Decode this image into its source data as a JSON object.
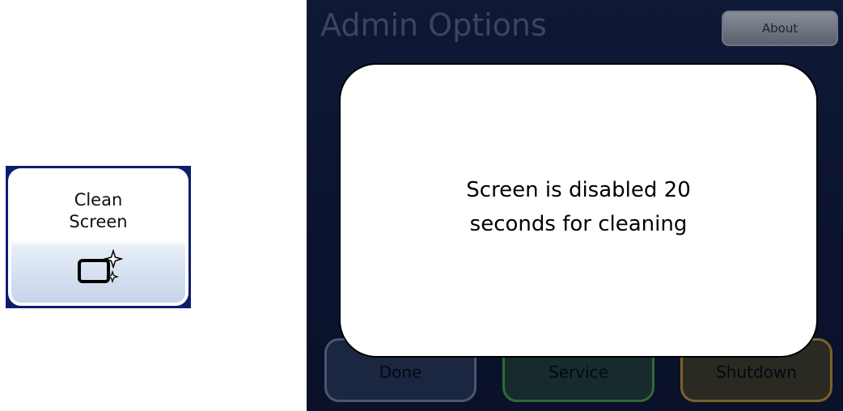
{
  "clean_screen_button": {
    "label": "Clean\nScreen",
    "icon": "clean-screen-sparkle-icon"
  },
  "screen": {
    "title": "Admin Options",
    "about_label": "About",
    "buttons": {
      "done": "Done",
      "service": "Service",
      "shutdown": "Shutdown"
    }
  },
  "modal": {
    "message": "Screen is disabled 20\nseconds for cleaning"
  },
  "colors": {
    "screen_background": "#0f1935",
    "frame_blue": "#0c1d6e",
    "service_border": "#2f6a38",
    "shutdown_border": "#7b6226"
  }
}
